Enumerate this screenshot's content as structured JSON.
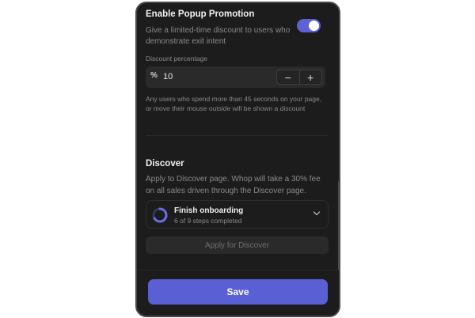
{
  "popup": {
    "title": "Enable Popup Promotion",
    "description": "Give a limited-time discount to users who demonstrate exit intent",
    "toggle_on": true,
    "discount_label": "Discount percentage",
    "discount_icon": "%",
    "discount_value": "10",
    "minus_symbol": "−",
    "plus_symbol": "+",
    "helper_text": "Any users who spend more than 45 seconds on your page, or move their mouse outside will be shown a discount"
  },
  "discover": {
    "title": "Discover",
    "description": "Apply to Discover page. Whop will take a 30% fee on all sales driven through the Discover page.",
    "onboarding_title": "Finish onboarding",
    "onboarding_progress": "6 of 9 steps completed",
    "steps_completed": 6,
    "steps_total": 9,
    "apply_label": "Apply for Discover"
  },
  "footer": {
    "save_label": "Save"
  },
  "colors": {
    "accent": "#5b5fd4",
    "panel_bg": "#1c1c1c"
  }
}
